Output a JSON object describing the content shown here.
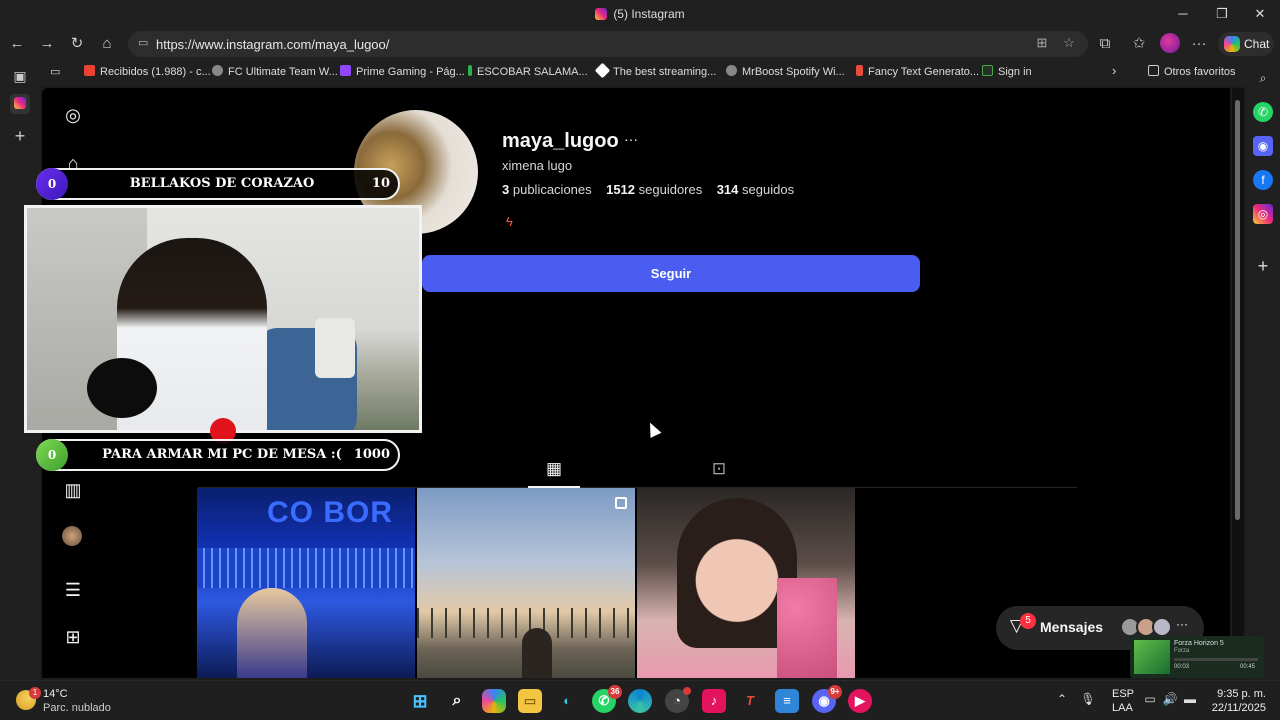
{
  "window": {
    "title": "(5) Instagram",
    "minimize": "─",
    "maximize": "❐",
    "close": "✕"
  },
  "browser": {
    "url": "https://www.instagram.com/maya_lugoo/",
    "chat_label": "Chat",
    "bookmarks": [
      {
        "label": "Recibidos (1.988) - c...",
        "color": "#ea4335"
      },
      {
        "label": "FC Ultimate Team W...",
        "color": "#888888"
      },
      {
        "label": "Prime Gaming - Pág...",
        "color": "#9146ff"
      },
      {
        "label": "ESCOBAR SALAMA...",
        "color": "#2bb24c"
      },
      {
        "label": "The best streaming...",
        "color": "#ffffff"
      },
      {
        "label": "MrBoost Spotify Wi...",
        "color": "#888888"
      },
      {
        "label": "Fancy Text Generato...",
        "color": "#e84c3d"
      },
      {
        "label": "Sign in",
        "color": "#2b2b2b"
      }
    ],
    "other_favorites": "Otros favoritos"
  },
  "profile": {
    "username": "maya_lugoo",
    "more": "···",
    "full_name": "ximena lugo",
    "posts_count": "3",
    "posts_label": "publicaciones",
    "followers_count": "1512",
    "followers_label": "seguidores",
    "following_count": "314",
    "following_label": "seguidos",
    "bio_emoji": "ϟ",
    "follow_button": "Seguir"
  },
  "posts": [
    {
      "overlay_text": "CO BOR"
    },
    {
      "overlay_text": ""
    },
    {
      "overlay_text": ""
    }
  ],
  "messages": {
    "label": "Mensajes",
    "badge": "5",
    "more": "···"
  },
  "stream_overlay": {
    "goal_top": {
      "current": "0",
      "title": "BELLAKOS DE CORAZAO",
      "target": "10"
    },
    "goal_bottom": {
      "current": "0",
      "title": "PARA ARMAR MI PC DE MESA :(",
      "target": "1000"
    }
  },
  "game_widget": {
    "title": "Forza Horizon 5",
    "subtitle": "Forza",
    "elapsed": "00:03",
    "total": "00:45"
  },
  "taskbar": {
    "weather_temp": "14°C",
    "weather_desc": "Parc. nublado",
    "weather_badge": "1",
    "whatsapp_badge": "36",
    "discord_badge": "9+",
    "lang1": "ESP",
    "lang2": "LAA",
    "time": "9:35 p. m.",
    "date": "22/11/2025"
  }
}
